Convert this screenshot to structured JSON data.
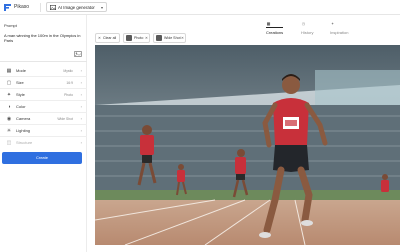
{
  "app": {
    "name": "Pikaso",
    "generator_label": "AI Image generator"
  },
  "sidebar": {
    "prompt_title": "Prompt",
    "prompt_text": "A man winning the 100m in the Olympics in Paris",
    "settings": [
      {
        "label": "Mode",
        "value": "Mystic",
        "icon": "mode-icon"
      },
      {
        "label": "Size",
        "value": "16:9",
        "icon": "size-icon"
      },
      {
        "label": "Style",
        "value": "Photo",
        "icon": "style-icon"
      },
      {
        "label": "Color",
        "value": "",
        "icon": "color-icon"
      },
      {
        "label": "Camera",
        "value": "Wide Shot",
        "icon": "camera-icon"
      },
      {
        "label": "Lighting",
        "value": "",
        "icon": "lighting-icon"
      },
      {
        "label": "Structure",
        "value": "",
        "icon": "structure-icon"
      }
    ],
    "create_label": "Create"
  },
  "tabs": [
    {
      "label": "Creations",
      "icon": "grid-icon",
      "active": true
    },
    {
      "label": "History",
      "icon": "clock-icon",
      "active": false
    },
    {
      "label": "Inspiration",
      "icon": "sparkle-icon",
      "active": false
    }
  ],
  "toolbar": {
    "clear_all": "Clear all",
    "chips": [
      {
        "label": "Photo"
      },
      {
        "label": "Wide Shot"
      }
    ]
  },
  "colors": {
    "accent": "#2f6fe0",
    "jersey_red": "#c8303a"
  }
}
